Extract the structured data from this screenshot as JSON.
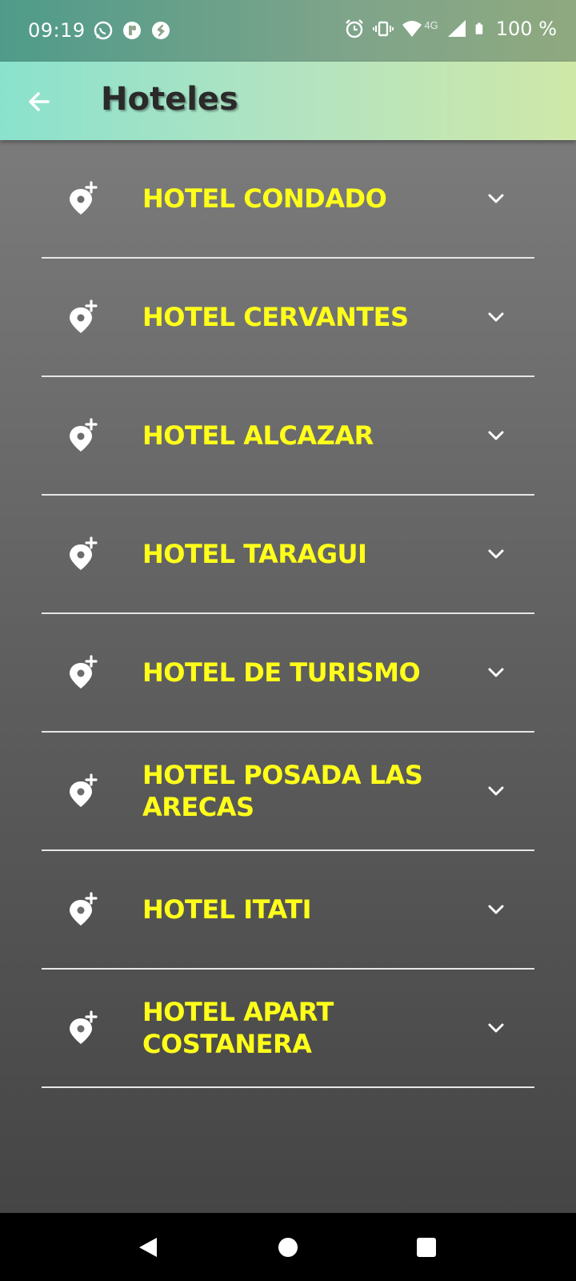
{
  "status_bar": {
    "time": "09:19",
    "battery": "100 %",
    "network": "4G",
    "left_icons": [
      "whatsapp-icon",
      "app-notification-icon",
      "shazam-icon"
    ],
    "right_icons": [
      "alarm-icon",
      "vibrate-icon",
      "wifi-icon",
      "signal-icon",
      "battery-icon"
    ]
  },
  "app_bar": {
    "title": "Hoteles",
    "back_icon": "arrow-back-icon"
  },
  "hotels": [
    {
      "label": "HOTEL CONDADO"
    },
    {
      "label": "HOTEL CERVANTES"
    },
    {
      "label": "HOTEL ALCAZAR"
    },
    {
      "label": "HOTEL TARAGUI"
    },
    {
      "label": "HOTEL DE TURISMO"
    },
    {
      "label": "HOTEL  POSADA LAS ARECAS"
    },
    {
      "label": "HOTEL ITATI"
    },
    {
      "label": "HOTEL APART COSTANERA"
    }
  ],
  "item_icon": "add-location-icon",
  "item_chevron": "chevron-down-icon",
  "colors": {
    "label": "#ffff1a",
    "divider": "#e6e6e6"
  },
  "nav_bar": {
    "icons": [
      "back-triangle-icon",
      "home-circle-icon",
      "recents-square-icon"
    ]
  }
}
